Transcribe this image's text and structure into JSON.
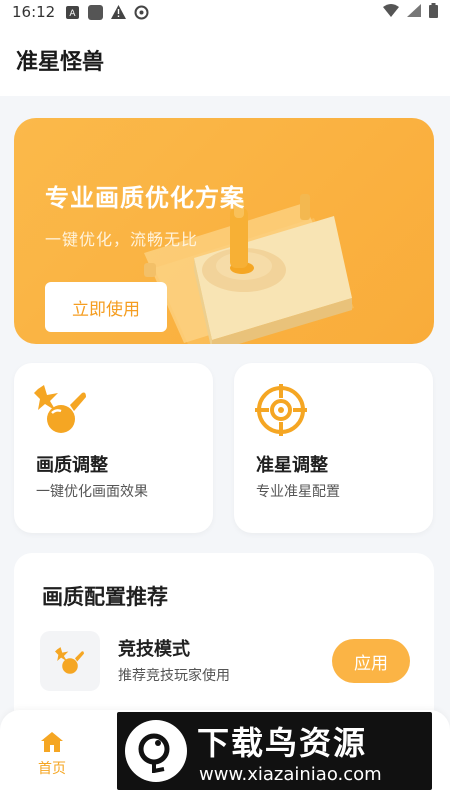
{
  "status_bar": {
    "time": "16:12",
    "left_icons": [
      "a-box-icon",
      "square-icon",
      "warning-icon",
      "sync-icon"
    ],
    "right_icons": [
      "wifi-icon",
      "signal-icon",
      "battery-icon"
    ]
  },
  "app_bar": {
    "title": "准星怪兽"
  },
  "banner": {
    "title": "专业画质优化方案",
    "subtitle": "一键优化，流畅无比",
    "button_label": "立即使用"
  },
  "features": [
    {
      "title": "画质调整",
      "subtitle": "一键优化画面效果",
      "icon": "paint-brush-icon"
    },
    {
      "title": "准星调整",
      "subtitle": "专业准星配置",
      "icon": "crosshair-icon"
    }
  ],
  "recommend": {
    "title": "画质配置推荐",
    "items": [
      {
        "title": "竞技模式",
        "subtitle": "推荐竞技玩家使用",
        "action": "应用",
        "icon": "paint-brush-icon"
      }
    ]
  },
  "bottom_nav": {
    "items": [
      {
        "label": "首页",
        "icon": "home-icon",
        "active": true
      }
    ]
  },
  "watermark": {
    "title": "下载鸟资源",
    "url": "www.xiazainiao.com"
  },
  "colors": {
    "accent": "#f9ac3a",
    "accent_text": "#f5a623",
    "background": "#f4f6f9"
  }
}
